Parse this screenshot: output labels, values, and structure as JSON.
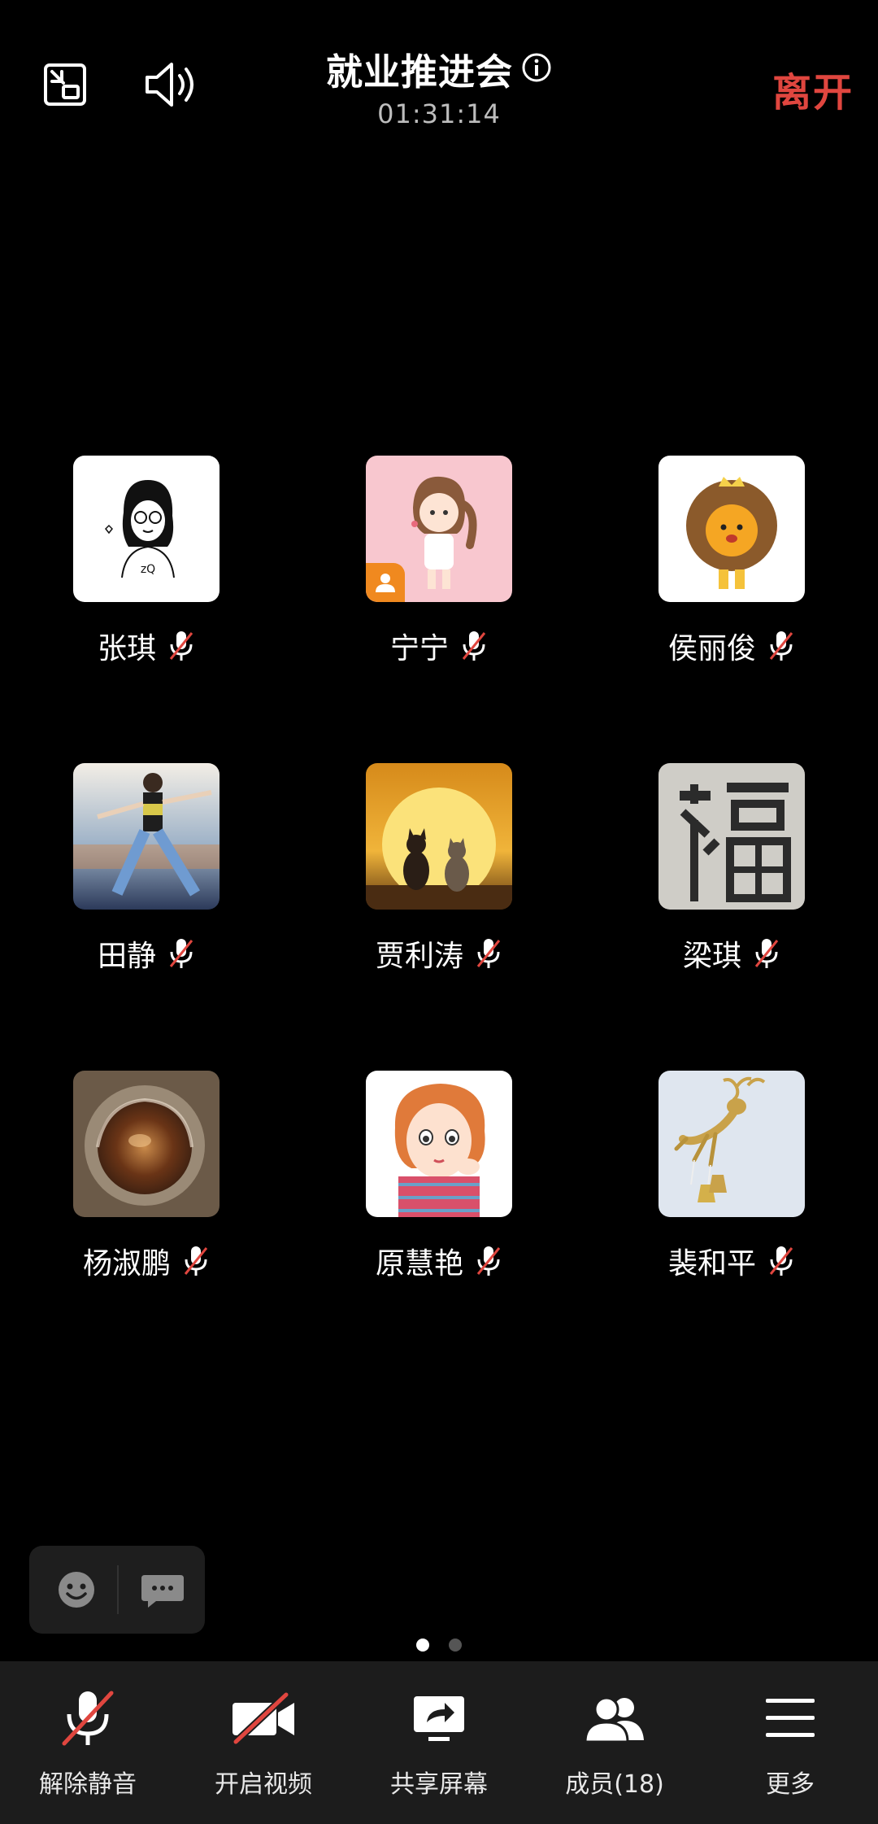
{
  "header": {
    "title": "就业推进会",
    "timer": "01:31:14",
    "leave_label": "离开"
  },
  "participants": [
    {
      "name": "张琪"
    },
    {
      "name": "宁宁"
    },
    {
      "name": "侯丽俊"
    },
    {
      "name": "田静"
    },
    {
      "name": "贾利涛"
    },
    {
      "name": "梁琪"
    },
    {
      "name": "杨淑鹏"
    },
    {
      "name": "原慧艳"
    },
    {
      "name": "裴和平"
    }
  ],
  "pager": {
    "current": 1,
    "total": 2
  },
  "toolbar": {
    "unmute_label": "解除静音",
    "video_label": "开启视频",
    "share_label": "共享屏幕",
    "members_label": "成员(18)",
    "more_label": "更多"
  },
  "colors": {
    "accent_red": "#e0463f",
    "host_badge": "#f0891f",
    "toolbar_bg": "#1c1c1c"
  }
}
